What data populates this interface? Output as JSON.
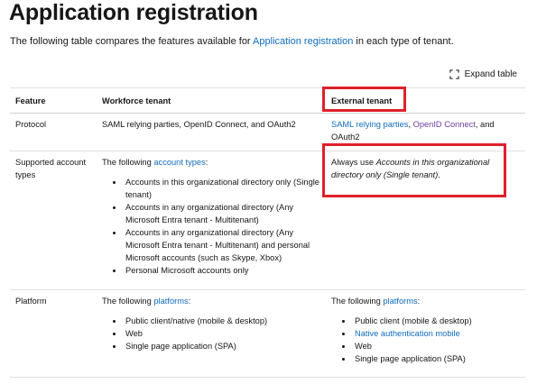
{
  "page": {
    "title": "Application registration",
    "intro_prefix": "The following table compares the features available for ",
    "intro_link": "Application registration",
    "intro_suffix": " in each type of tenant."
  },
  "toolbar": {
    "expand_label": "Expand table"
  },
  "table": {
    "headers": [
      "Feature",
      "Workforce tenant",
      "External tenant"
    ],
    "protocol": {
      "feature": "Protocol",
      "workforce": "SAML relying parties, OpenID Connect, and OAuth2",
      "external_link1": "SAML relying parties",
      "external_sep": ", ",
      "external_link2": "OpenID Connect",
      "external_suffix": ", and OAuth2"
    },
    "accounts": {
      "feature": "Supported account types",
      "workforce_prefix": "The following ",
      "workforce_link": "account types",
      "workforce_suffix": ":",
      "workforce_items": [
        "Accounts in this organizational directory only (Single tenant)",
        "Accounts in any organizational directory (Any Microsoft Entra tenant - Multitenant)",
        "Accounts in any organizational directory (Any Microsoft Entra tenant - Multitenant) and personal Microsoft accounts (such as Skype, Xbox)",
        "Personal Microsoft accounts only"
      ],
      "external_prefix": "Always use ",
      "external_em": "Accounts in this organizational directory only (Single tenant)",
      "external_suffix": "."
    },
    "platform": {
      "feature": "Platform",
      "workforce_prefix": "The following ",
      "workforce_link": "platforms",
      "workforce_suffix": ":",
      "workforce_items": [
        "Public client/native (mobile & desktop)",
        "Web",
        "Single page application (SPA)"
      ],
      "external_prefix": "The following ",
      "external_link": "platforms",
      "external_suffix": ":",
      "external_items": [
        "Public client (mobile & desktop)",
        "Native authentication mobile",
        "Web",
        "Single page application (SPA)"
      ]
    }
  },
  "colors": {
    "link": "#0f6cbd",
    "visited": "#6b3fa0",
    "highlight": "#e0202a"
  }
}
